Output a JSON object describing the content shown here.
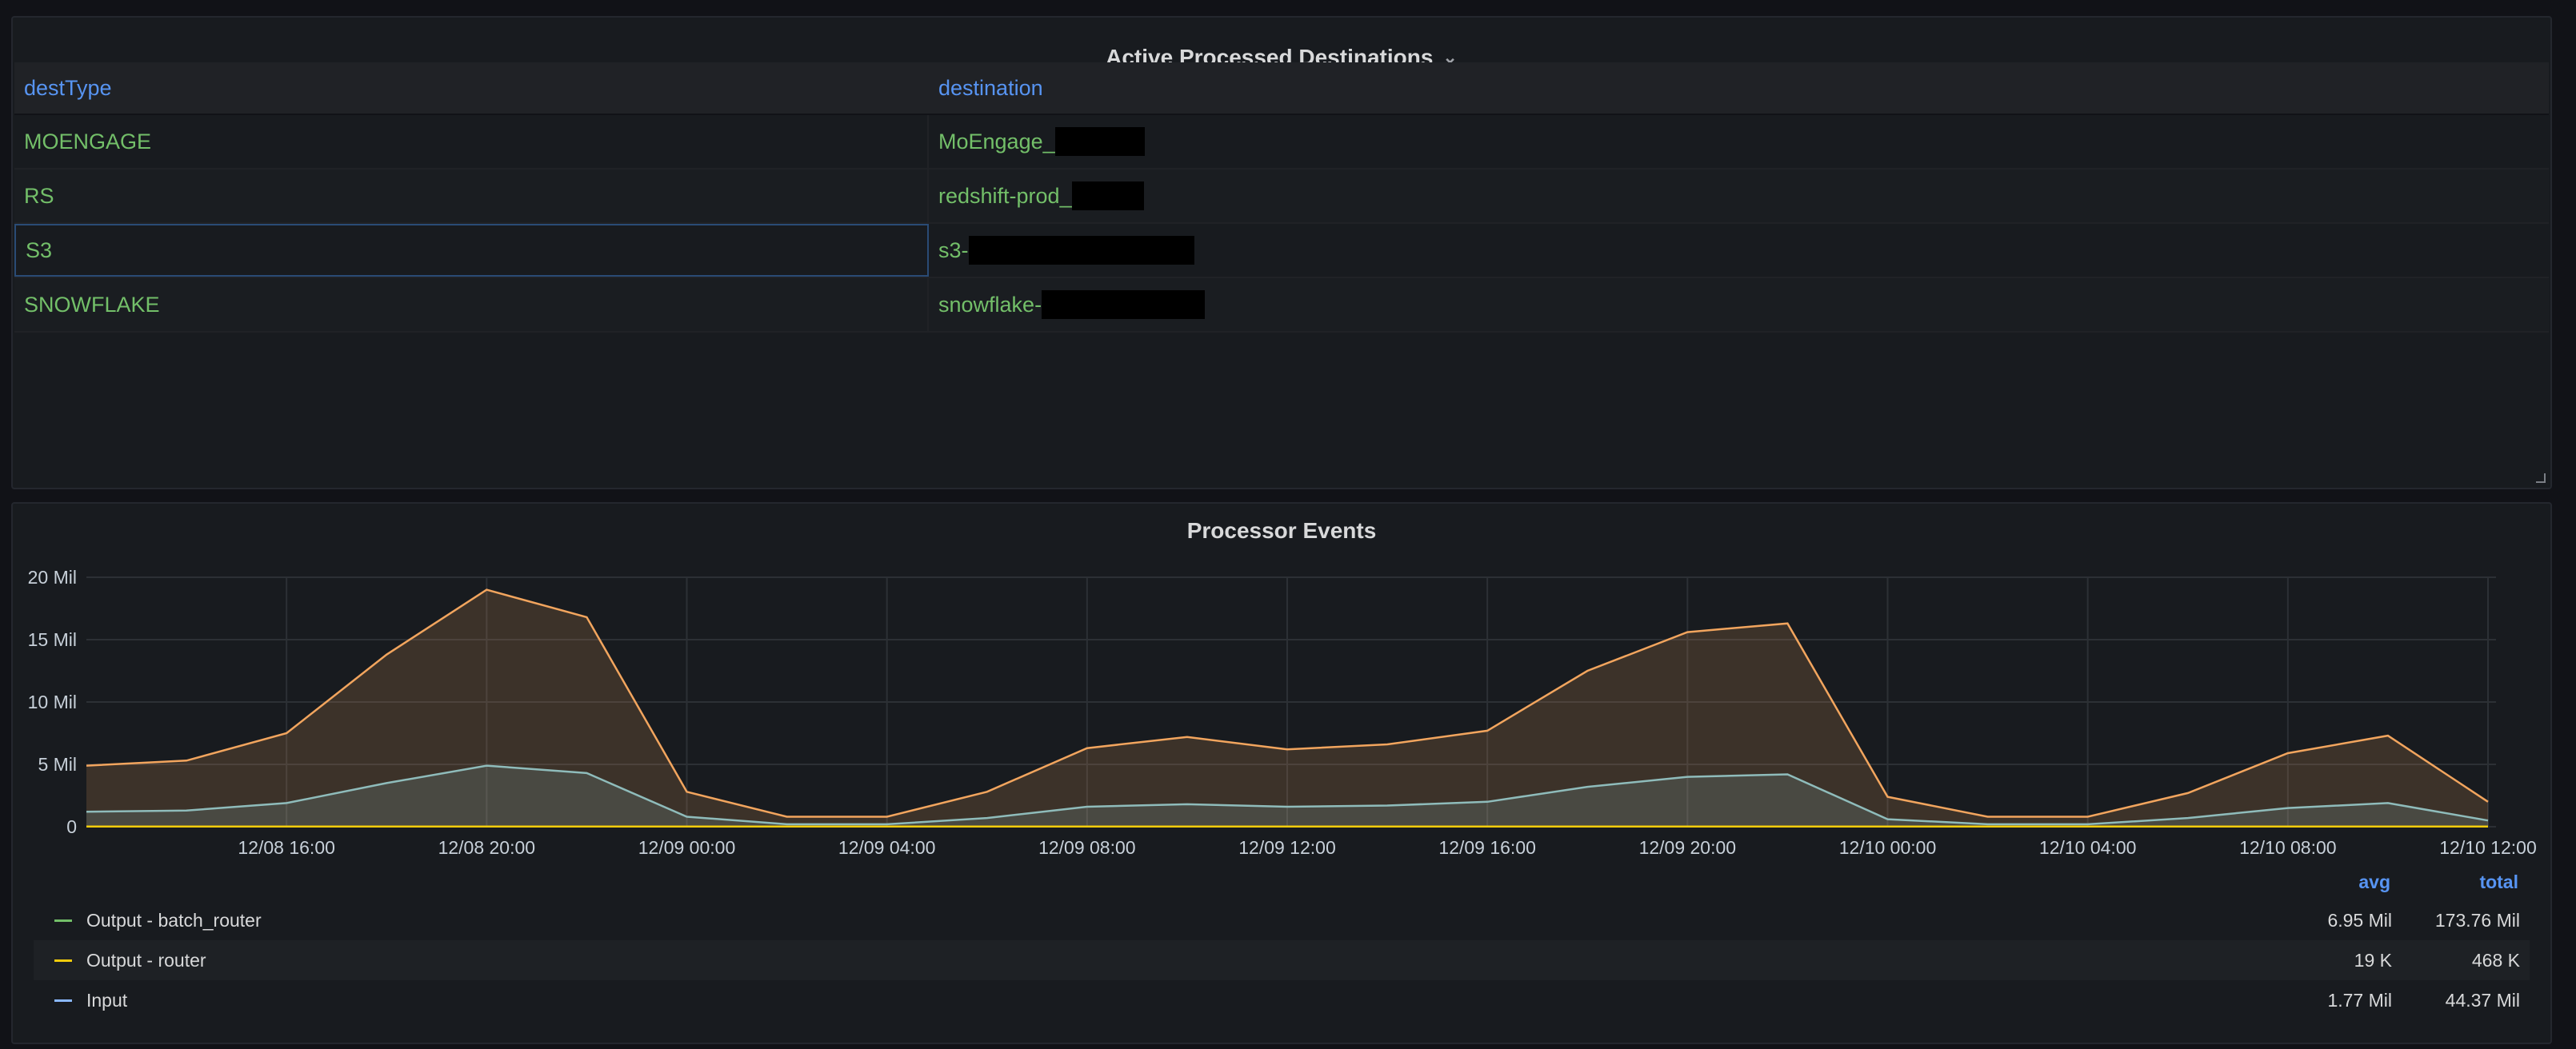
{
  "table_panel": {
    "title": "Active Processed Destinations",
    "columns": [
      "destType",
      "destination"
    ],
    "rows": [
      {
        "destType": "MOENGAGE",
        "destination": "MoEngage_"
      },
      {
        "destType": "RS",
        "destination": "redshift-prod_"
      },
      {
        "destType": "S3",
        "destination": "s3-"
      },
      {
        "destType": "SNOWFLAKE",
        "destination": "snowflake-"
      }
    ],
    "value_color": "#73bf69",
    "header_color": "#5794f2"
  },
  "chart_panel": {
    "title": "Processor Events",
    "legend": {
      "headers": {
        "avg": "avg",
        "total": "total"
      },
      "items": [
        {
          "name": "Output - batch_router",
          "avg": "6.95 Mil",
          "total": "173.76 Mil",
          "color": "#73bf69"
        },
        {
          "name": "Output - router",
          "avg": "19 K",
          "total": "468 K",
          "color": "#f2cc0c"
        },
        {
          "name": "Input",
          "avg": "1.77 Mil",
          "total": "44.37 Mil",
          "color": "#8ab8ff"
        }
      ]
    }
  },
  "chart_data": {
    "type": "area",
    "title": "Processor Events",
    "x": [
      "12/08 13:00",
      "12/08 14:00",
      "12/08 16:00",
      "12/08 18:00",
      "12/08 20:00",
      "12/08 22:00",
      "12/09 00:00",
      "12/09 02:00",
      "12/09 04:00",
      "12/09 06:00",
      "12/09 08:00",
      "12/09 10:00",
      "12/09 12:00",
      "12/09 14:00",
      "12/09 16:00",
      "12/09 18:00",
      "12/09 20:00",
      "12/09 22:00",
      "12/10 00:00",
      "12/10 02:00",
      "12/10 04:00",
      "12/10 06:00",
      "12/10 08:00",
      "12/10 10:00",
      "12/10 12:00"
    ],
    "x_ticks": [
      "12/08 16:00",
      "12/08 20:00",
      "12/09 00:00",
      "12/09 04:00",
      "12/09 08:00",
      "12/09 12:00",
      "12/09 16:00",
      "12/09 20:00",
      "12/10 00:00",
      "12/10 04:00",
      "12/10 08:00",
      "12/10 12:00"
    ],
    "y_ticks": [
      "0",
      "5 Mil",
      "10 Mil",
      "15 Mil",
      "20 Mil"
    ],
    "ylim": [
      0,
      20000000
    ],
    "grid": true,
    "series": [
      {
        "name": "Output - batch_router",
        "color": "#f2a55e",
        "values": [
          4.9,
          5.3,
          7.5,
          13.8,
          19.0,
          16.8,
          2.8,
          0.8,
          0.8,
          2.8,
          6.3,
          7.2,
          6.2,
          6.6,
          7.7,
          12.5,
          15.6,
          16.3,
          2.4,
          0.8,
          0.8,
          2.7,
          5.9,
          7.3,
          2.0
        ]
      },
      {
        "name": "Input",
        "color": "#8fbcbb",
        "values": [
          1.2,
          1.3,
          1.9,
          3.5,
          4.9,
          4.3,
          0.8,
          0.2,
          0.2,
          0.7,
          1.6,
          1.8,
          1.6,
          1.7,
          2.0,
          3.2,
          4.0,
          4.2,
          0.6,
          0.2,
          0.2,
          0.7,
          1.5,
          1.9,
          0.5
        ]
      },
      {
        "name": "Output - router",
        "color": "#f2cc0c",
        "values": [
          0.02,
          0.02,
          0.02,
          0.02,
          0.02,
          0.02,
          0.02,
          0.02,
          0.02,
          0.02,
          0.02,
          0.02,
          0.02,
          0.02,
          0.02,
          0.02,
          0.02,
          0.02,
          0.02,
          0.02,
          0.02,
          0.02,
          0.02,
          0.02,
          0.02
        ]
      }
    ],
    "unit": "Mil"
  }
}
